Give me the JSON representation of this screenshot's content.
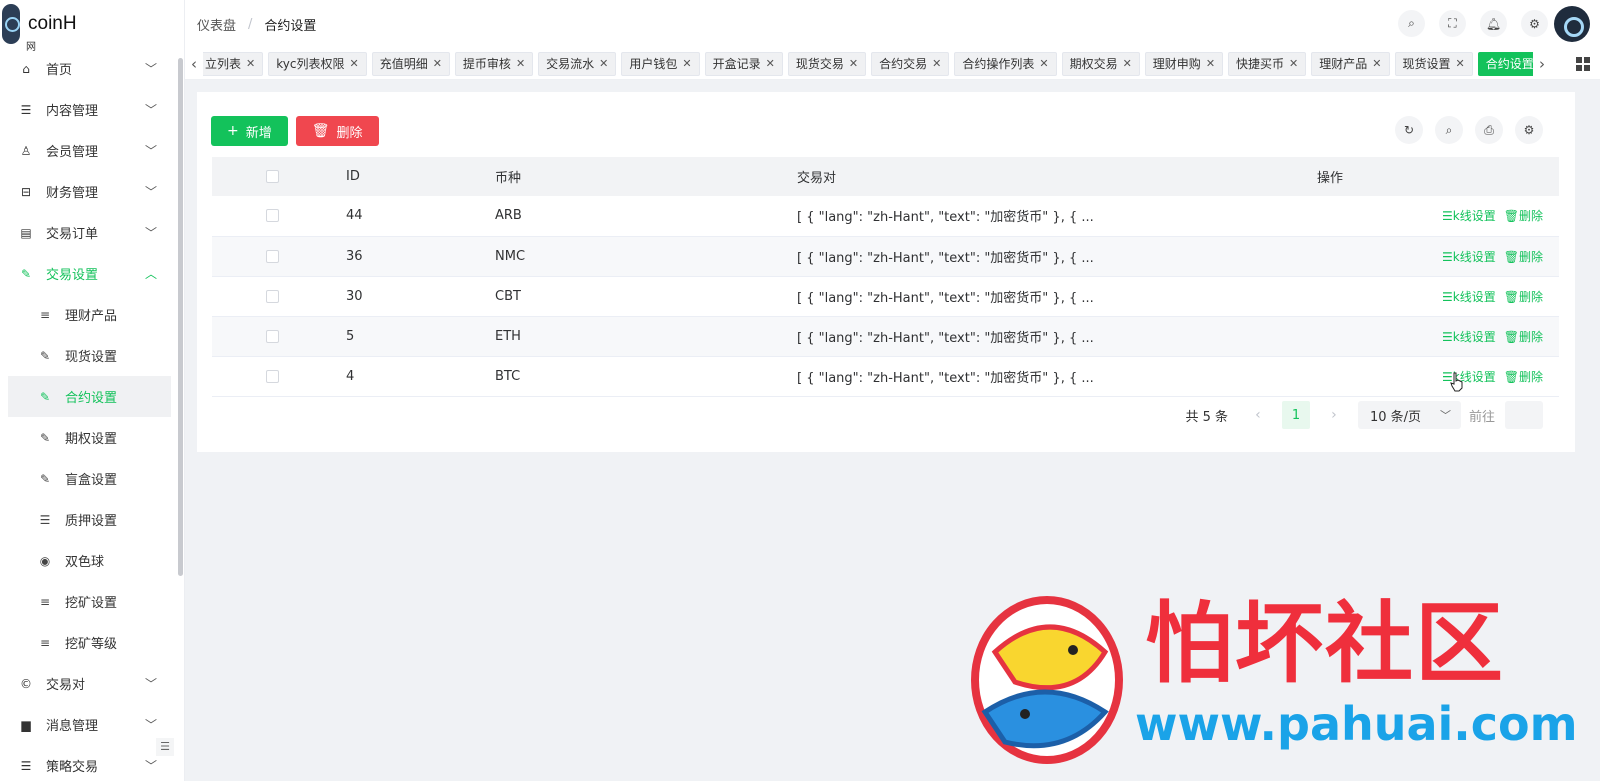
{
  "app": {
    "name": "coinH",
    "sub": "网"
  },
  "sidebar": {
    "items": [
      {
        "icon": "home-icon",
        "glyph": "⌂",
        "label": "首页",
        "arrow": "﹀"
      },
      {
        "icon": "list-icon",
        "glyph": "☰",
        "label": "内容管理",
        "arrow": "﹀"
      },
      {
        "icon": "user-icon",
        "glyph": "♙",
        "label": "会员管理",
        "arrow": "﹀"
      },
      {
        "icon": "finance-icon",
        "glyph": "⊟",
        "label": "财务管理",
        "arrow": "﹀"
      },
      {
        "icon": "order-icon",
        "glyph": "▤",
        "label": "交易订单",
        "arrow": "﹀"
      },
      {
        "icon": "wrench-icon",
        "glyph": "✎",
        "label": "交易设置",
        "arrow": "︿"
      }
    ],
    "sub_items": [
      {
        "icon": "sort-icon",
        "glyph": "≡",
        "label": "理财产品"
      },
      {
        "icon": "wrench-icon",
        "glyph": "✎",
        "label": "现货设置"
      },
      {
        "icon": "wrench-icon",
        "glyph": "✎",
        "label": "合约设置"
      },
      {
        "icon": "wrench-icon",
        "glyph": "✎",
        "label": "期权设置"
      },
      {
        "icon": "wrench-icon",
        "glyph": "✎",
        "label": "盲盒设置"
      },
      {
        "icon": "list-icon",
        "glyph": "☰",
        "label": "质押设置"
      },
      {
        "icon": "target-icon",
        "glyph": "◉",
        "label": "双色球"
      },
      {
        "icon": "align-icon",
        "glyph": "≡",
        "label": "挖矿设置"
      },
      {
        "icon": "align-icon",
        "glyph": "≡",
        "label": "挖矿等级"
      }
    ],
    "bottom_items": [
      {
        "icon": "copyright-icon",
        "glyph": "©",
        "label": "交易对",
        "arrow": "﹀"
      },
      {
        "icon": "message-icon",
        "glyph": "▆",
        "label": "消息管理",
        "arrow": "﹀"
      },
      {
        "icon": "strategy-icon",
        "glyph": "☰",
        "label": "策略交易",
        "arrow": "﹀"
      }
    ],
    "collapse_glyph": "☰"
  },
  "header": {
    "breadcrumb": [
      "仪表盘",
      "合约设置"
    ],
    "sep": "/",
    "actions": [
      {
        "name": "search-icon",
        "glyph": "⌕"
      },
      {
        "name": "fullscreen-icon",
        "glyph": "⛶"
      },
      {
        "name": "bell-icon",
        "glyph": "🔔︎"
      },
      {
        "name": "settings-icon",
        "glyph": "⚙"
      }
    ]
  },
  "tabs": {
    "items": [
      "立列表",
      "kyc列表权限",
      "充值明细",
      "提币审核",
      "交易流水",
      "用户钱包",
      "开盒记录",
      "现货交易",
      "合约交易",
      "合约操作列表",
      "期权交易",
      "理财申购",
      "快捷买币",
      "理财产品",
      "现货设置",
      "合约设置"
    ],
    "active": 15,
    "close": "✕",
    "left": "‹",
    "right": "›"
  },
  "toolbar": {
    "add_label": "新增",
    "add_glyph": "+",
    "delete_label": "删除",
    "delete_glyph": "🗑︎",
    "right": [
      {
        "name": "refresh-icon",
        "glyph": "↻"
      },
      {
        "name": "search-icon",
        "glyph": "⌕"
      },
      {
        "name": "print-icon",
        "glyph": "⎙"
      },
      {
        "name": "settings-icon",
        "glyph": "⚙"
      }
    ]
  },
  "table": {
    "columns": [
      "ID",
      "币种",
      "交易对",
      "操作"
    ],
    "rows": [
      {
        "id": "44",
        "coin": "ARB",
        "pair": "[ { \"lang\": \"zh-Hant\", \"text\": \"加密货币\" }, { ..."
      },
      {
        "id": "36",
        "coin": "NMC",
        "pair": "[ { \"lang\": \"zh-Hant\", \"text\": \"加密货币\" }, { ..."
      },
      {
        "id": "30",
        "coin": "CBT",
        "pair": "[ { \"lang\": \"zh-Hant\", \"text\": \"加密货币\" }, { ..."
      },
      {
        "id": "5",
        "coin": "ETH",
        "pair": "[ { \"lang\": \"zh-Hant\", \"text\": \"加密货币\" }, { ..."
      },
      {
        "id": "4",
        "coin": "BTC",
        "pair": "[ { \"lang\": \"zh-Hant\", \"text\": \"加密货币\" }, { ..."
      }
    ],
    "op_kline": "☰k线设置",
    "op_delete": "🗑︎删除"
  },
  "pager": {
    "total": "共 5 条",
    "page": "1",
    "size": "10 条/页",
    "goto": "前往",
    "prev": "‹",
    "next": "›",
    "chev": "﹀"
  },
  "watermark": {
    "title": "怕坏社区",
    "url": "www.pahuai.com"
  },
  "colors": {
    "primary": "#13c25b",
    "danger": "#f0474f"
  }
}
